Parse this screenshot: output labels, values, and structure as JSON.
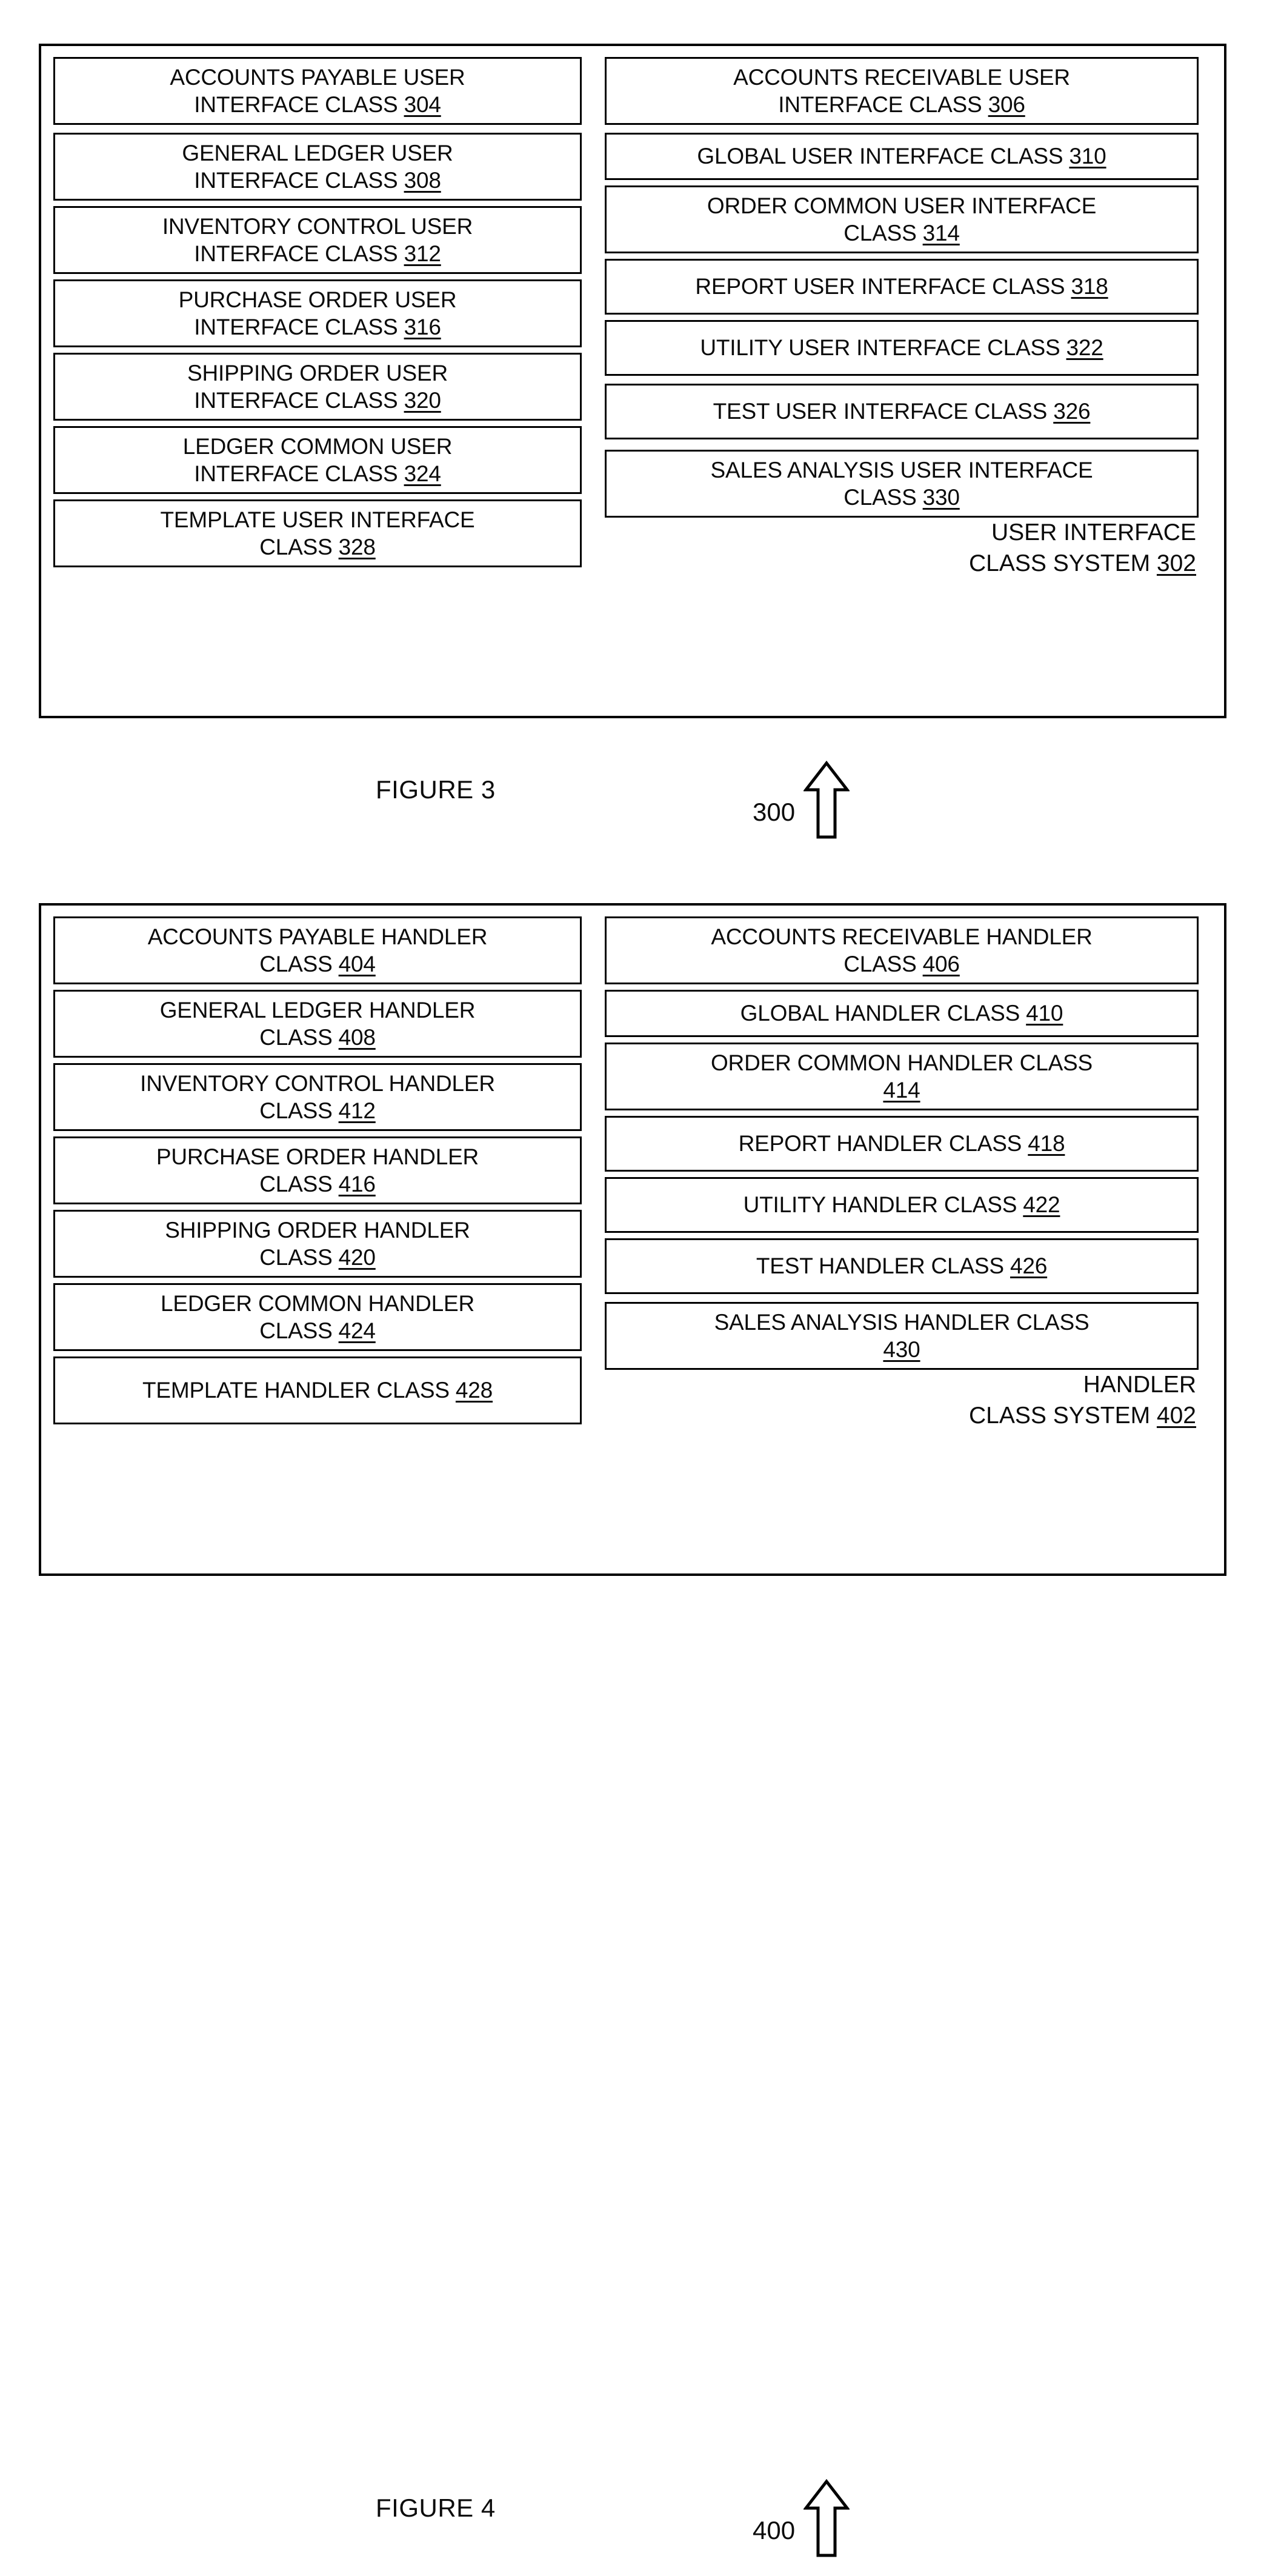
{
  "figures": [
    {
      "id": "figure-3",
      "caption": "FIGURE 3",
      "callout_number": "300",
      "system_caption_line1": "USER INTERFACE",
      "system_caption_line2": "CLASS SYSTEM ",
      "system_caption_ref": "302",
      "left_column": [
        {
          "line1": "ACCOUNTS PAYABLE USER",
          "line2": "INTERFACE CLASS ",
          "ref": "304"
        },
        {
          "line1": "GENERAL LEDGER USER",
          "line2": "INTERFACE CLASS ",
          "ref": "308"
        },
        {
          "line1": "INVENTORY CONTROL USER",
          "line2": "INTERFACE CLASS ",
          "ref": "312"
        },
        {
          "line1": "PURCHASE ORDER USER",
          "line2": "INTERFACE CLASS ",
          "ref": "316"
        },
        {
          "line1": "SHIPPING ORDER USER",
          "line2": "INTERFACE CLASS ",
          "ref": "320"
        },
        {
          "line1": "LEDGER COMMON USER",
          "line2": "INTERFACE CLASS ",
          "ref": "324"
        },
        {
          "line1": "TEMPLATE USER INTERFACE",
          "line2": "CLASS ",
          "ref": "328"
        }
      ],
      "right_column": [
        {
          "line1": "ACCOUNTS RECEIVABLE USER",
          "line2": "INTERFACE CLASS ",
          "ref": "306"
        },
        {
          "line1": "GLOBAL USER INTERFACE CLASS ",
          "line2": "",
          "ref": "310"
        },
        {
          "line1": "ORDER COMMON USER INTERFACE",
          "line2": "CLASS ",
          "ref": "314"
        },
        {
          "line1": "REPORT USER INTERFACE CLASS ",
          "line2": "",
          "ref": "318"
        },
        {
          "line1": "UTILITY USER INTERFACE CLASS ",
          "line2": "",
          "ref": "322"
        },
        {
          "line1": "TEST USER INTERFACE CLASS ",
          "line2": "",
          "ref": "326"
        },
        {
          "line1": "SALES ANALYSIS USER INTERFACE",
          "line2": "CLASS ",
          "ref": "330"
        }
      ]
    },
    {
      "id": "figure-4",
      "caption": "FIGURE 4",
      "callout_number": "400",
      "system_caption_line1": "HANDLER",
      "system_caption_line2": "CLASS SYSTEM ",
      "system_caption_ref": "402",
      "left_column": [
        {
          "line1": "ACCOUNTS PAYABLE HANDLER",
          "line2": "CLASS ",
          "ref": "404"
        },
        {
          "line1": "GENERAL LEDGER HANDLER",
          "line2": "CLASS ",
          "ref": "408"
        },
        {
          "line1": "INVENTORY CONTROL HANDLER",
          "line2": "CLASS ",
          "ref": "412"
        },
        {
          "line1": "PURCHASE ORDER HANDLER",
          "line2": "CLASS ",
          "ref": "416"
        },
        {
          "line1": "SHIPPING ORDER HANDLER",
          "line2": "CLASS ",
          "ref": "420"
        },
        {
          "line1": "LEDGER COMMON HANDLER",
          "line2": "CLASS ",
          "ref": "424"
        },
        {
          "line1": "TEMPLATE HANDLER CLASS ",
          "line2": "",
          "ref": "428"
        }
      ],
      "right_column": [
        {
          "line1": "ACCOUNTS RECEIVABLE HANDLER",
          "line2": "CLASS ",
          "ref": "406"
        },
        {
          "line1": "GLOBAL HANDLER CLASS ",
          "line2": "",
          "ref": "410"
        },
        {
          "line1": "ORDER COMMON HANDLER CLASS",
          "line2": "",
          "ref": "414"
        },
        {
          "line1": "REPORT HANDLER CLASS ",
          "line2": "",
          "ref": "418"
        },
        {
          "line1": "UTILITY HANDLER CLASS ",
          "line2": "",
          "ref": "422"
        },
        {
          "line1": "TEST HANDLER CLASS ",
          "line2": "",
          "ref": "426"
        },
        {
          "line1": "SALES ANALYSIS HANDLER CLASS",
          "line2": "",
          "ref": "430"
        }
      ]
    }
  ]
}
